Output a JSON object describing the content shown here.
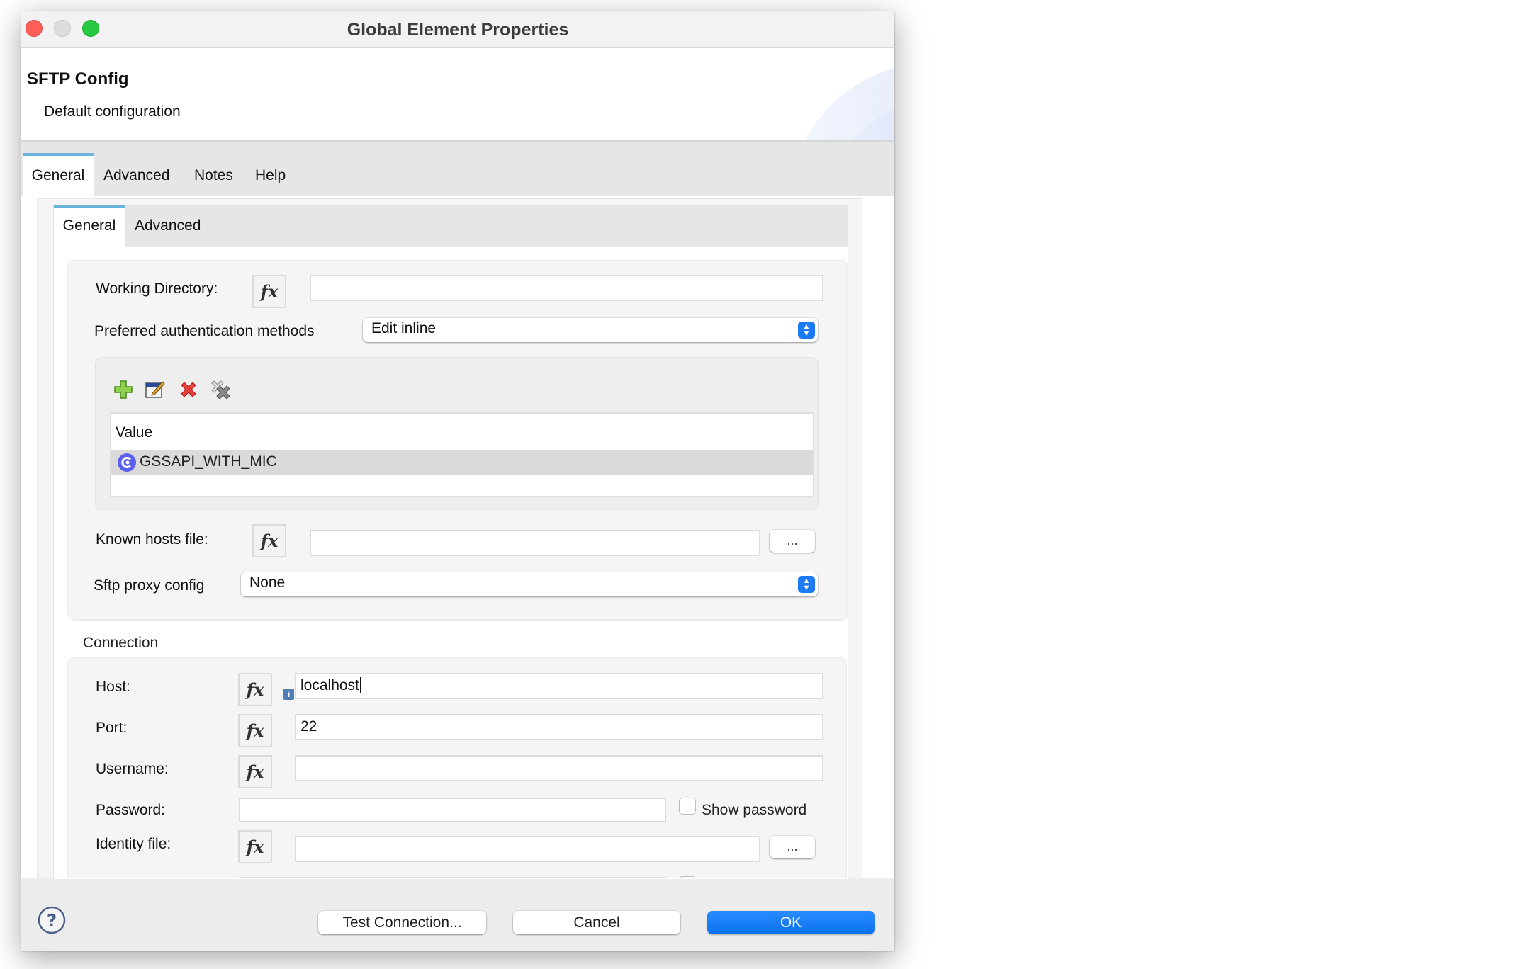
{
  "window": {
    "title": "Global Element Properties"
  },
  "header": {
    "title": "SFTP Config",
    "subtitle": "Default configuration"
  },
  "outer_tabs": [
    {
      "label": "General",
      "active": true
    },
    {
      "label": "Advanced",
      "active": false
    },
    {
      "label": "Notes",
      "active": false
    },
    {
      "label": "Help",
      "active": false
    }
  ],
  "inner_tabs": [
    {
      "label": "General",
      "active": true
    },
    {
      "label": "Advanced",
      "active": false
    }
  ],
  "general": {
    "working_directory": {
      "label": "Working Directory:",
      "value": ""
    },
    "auth_methods": {
      "label": "Preferred authentication methods",
      "selected": "Edit inline"
    },
    "auth_toolbar": {
      "add": "add-icon",
      "edit": "edit-icon",
      "delete": "delete-icon",
      "delete_all": "delete-all-icon"
    },
    "auth_table": {
      "column": "Value",
      "rows": [
        {
          "value": "GSSAPI_WITH_MIC",
          "selected": true
        }
      ]
    },
    "known_hosts": {
      "label": "Known hosts file:",
      "value": "",
      "browse_label": "..."
    },
    "proxy": {
      "label": "Sftp proxy config",
      "selected": "None"
    }
  },
  "connection": {
    "section_label": "Connection",
    "host": {
      "label": "Host:",
      "value": "localhost"
    },
    "port": {
      "label": "Port:",
      "value": "22"
    },
    "username": {
      "label": "Username:",
      "value": ""
    },
    "password": {
      "label": "Password:",
      "value": "",
      "show_password_label": "Show password",
      "show_password_checked": false
    },
    "identity_file": {
      "label": "Identity file:",
      "value": "",
      "browse_label": "..."
    }
  },
  "fx_label": "fx",
  "footer": {
    "help_icon": "help-icon",
    "test_connection": "Test Connection...",
    "cancel": "Cancel",
    "ok": "OK"
  },
  "colors": {
    "accent": "#0a72f0",
    "tab_indicator": "#6ab4dc",
    "enum_icon": "#5b5ff0"
  }
}
